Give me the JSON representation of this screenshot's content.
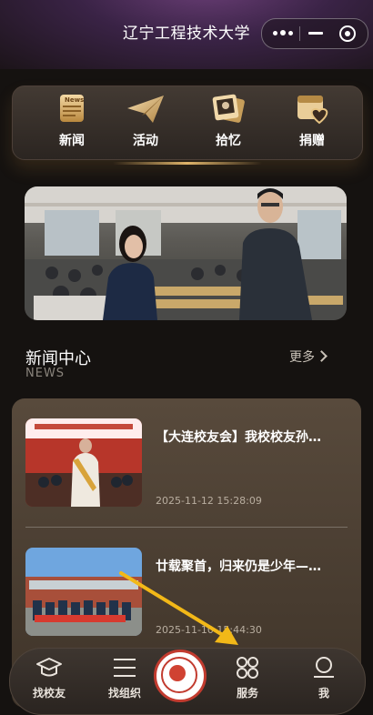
{
  "app": {
    "title": "辽宁工程技术大学"
  },
  "quick_menu": [
    {
      "label": "新闻",
      "icon": "news-icon",
      "badge": "News"
    },
    {
      "label": "活动",
      "icon": "paper-plane-icon"
    },
    {
      "label": "拾忆",
      "icon": "photo-memory-icon"
    },
    {
      "label": "捐赠",
      "icon": "donation-heart-icon"
    }
  ],
  "banner": {
    "icon": "lecture-photo"
  },
  "news_section": {
    "title": "新闻中心",
    "subtitle": "NEWS",
    "more_label": "更多"
  },
  "news": [
    {
      "headline": "【大连校友会】我校校友孙…",
      "date": "2025-11-12 15:28:09"
    },
    {
      "headline": "廿载聚首，归来仍是少年—…",
      "date": "2025-11-10 15:44:30"
    }
  ],
  "tabbar": [
    {
      "label": "找校友",
      "icon": "graduation-cap-icon"
    },
    {
      "label": "找组织",
      "icon": "menu-lines-icon"
    },
    {
      "label": "",
      "icon": "university-logo"
    },
    {
      "label": "服务",
      "icon": "grid-services-icon"
    },
    {
      "label": "我",
      "icon": "profile-icon"
    }
  ],
  "colors": {
    "accent": "#e0b46a",
    "card": "#4a3e33",
    "arrow": "#f2b818",
    "logo_red": "#c23b2f"
  }
}
